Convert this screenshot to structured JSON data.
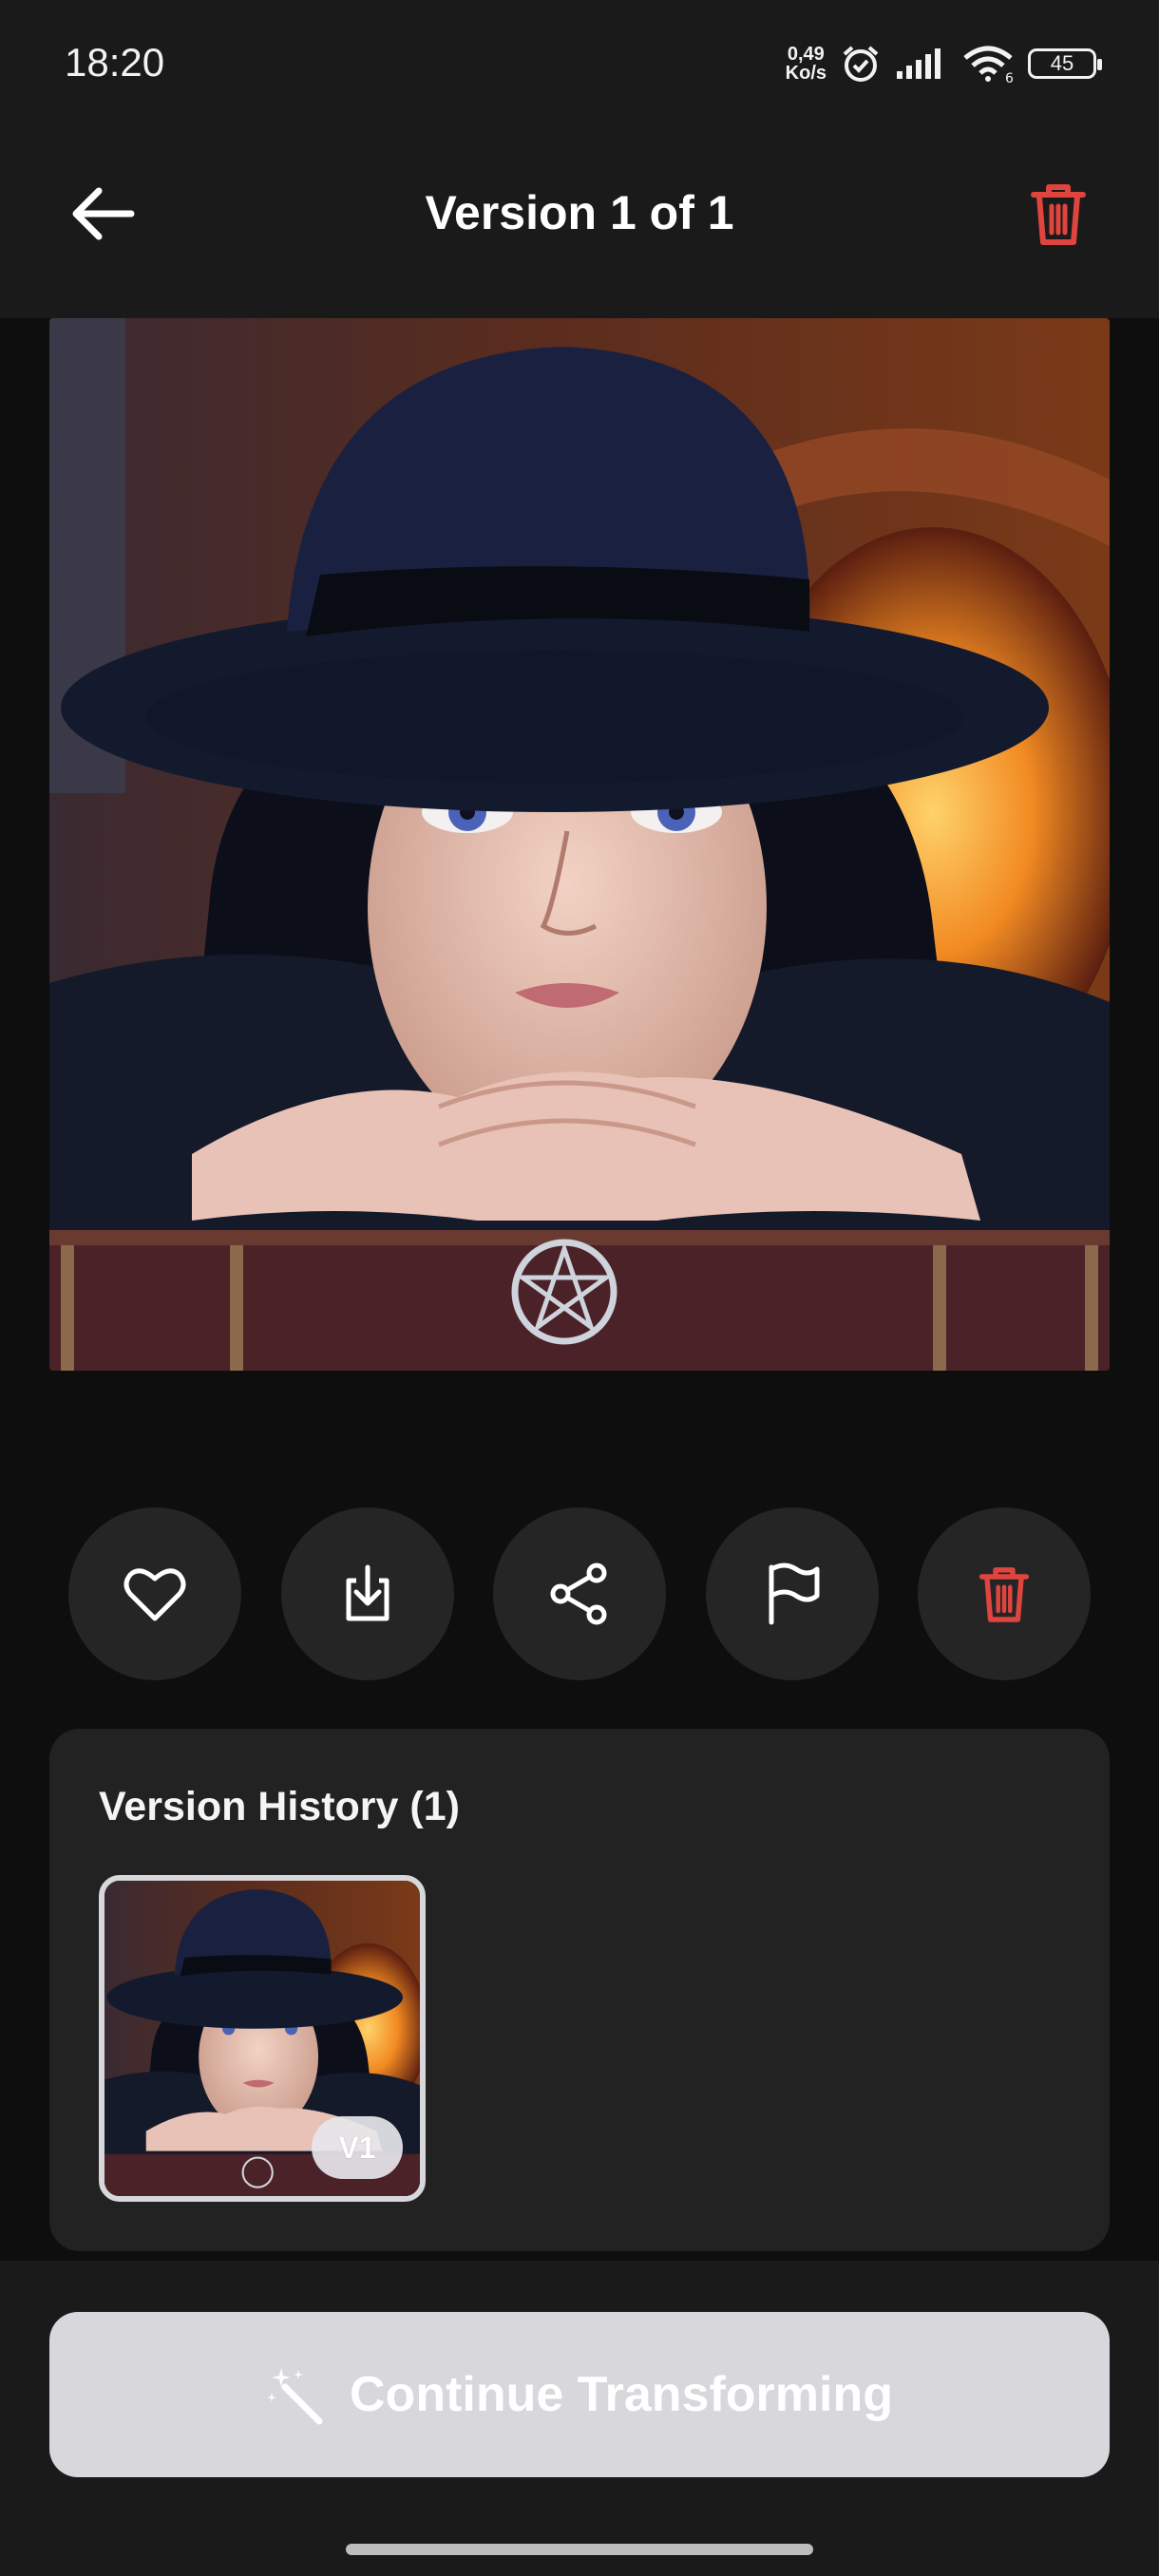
{
  "status_bar": {
    "time": "18:20",
    "net_speed_value": "0,49",
    "net_speed_unit": "Ko/s",
    "wifi_badge": "6",
    "battery": "45"
  },
  "header": {
    "title": "Version 1 of 1",
    "back_icon": "arrow-left-icon",
    "delete_icon": "trash-icon"
  },
  "actions": [
    {
      "name": "like",
      "icon": "heart-icon"
    },
    {
      "name": "download",
      "icon": "download-icon"
    },
    {
      "name": "share",
      "icon": "share-icon"
    },
    {
      "name": "report",
      "icon": "flag-icon"
    },
    {
      "name": "delete",
      "icon": "trash-icon"
    }
  ],
  "version_history": {
    "title": "Version History (1)",
    "items": [
      {
        "badge": "V1"
      }
    ]
  },
  "footer": {
    "continue_label": "Continue Transforming",
    "continue_icon": "magic-wand-icon"
  },
  "colors": {
    "accent_red": "#e0443e",
    "background": "#0e0e0e",
    "surface": "#1a1a1a",
    "card": "#222222",
    "button_disabled": "#d7d7dc"
  }
}
